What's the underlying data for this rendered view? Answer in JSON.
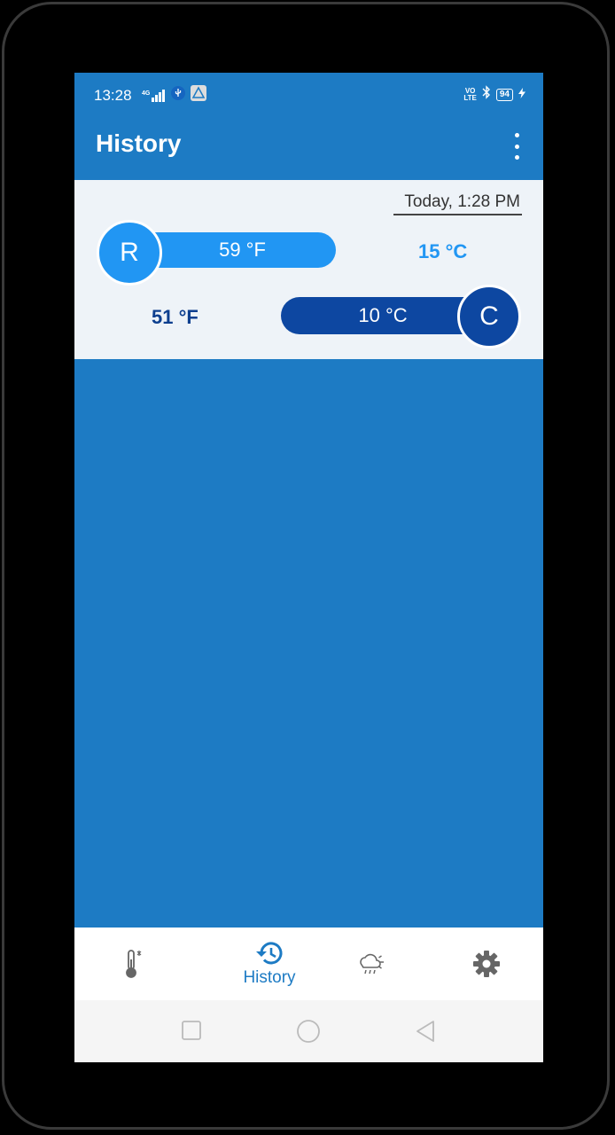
{
  "status_bar": {
    "time": "13:28",
    "network": "4G",
    "volte": "VO\nLTE",
    "battery": "94"
  },
  "app_bar": {
    "title": "History"
  },
  "history": {
    "entries": [
      {
        "timestamp": "Today, 1:28 PM",
        "r_label": "R",
        "r_value": "59 °F",
        "r_converted": "15 °C",
        "c_label": "C",
        "c_value": "10 °C",
        "c_converted": "51 °F"
      }
    ]
  },
  "bottom_nav": {
    "items": [
      {
        "icon": "thermometer-icon",
        "label": ""
      },
      {
        "icon": "history-icon",
        "label": "History",
        "active": true
      },
      {
        "icon": "weather-icon",
        "label": ""
      },
      {
        "icon": "gear-icon",
        "label": ""
      }
    ]
  },
  "colors": {
    "primary": "#1d7bc4",
    "accent_light": "#2196f3",
    "accent_dark": "#0d47a1"
  }
}
